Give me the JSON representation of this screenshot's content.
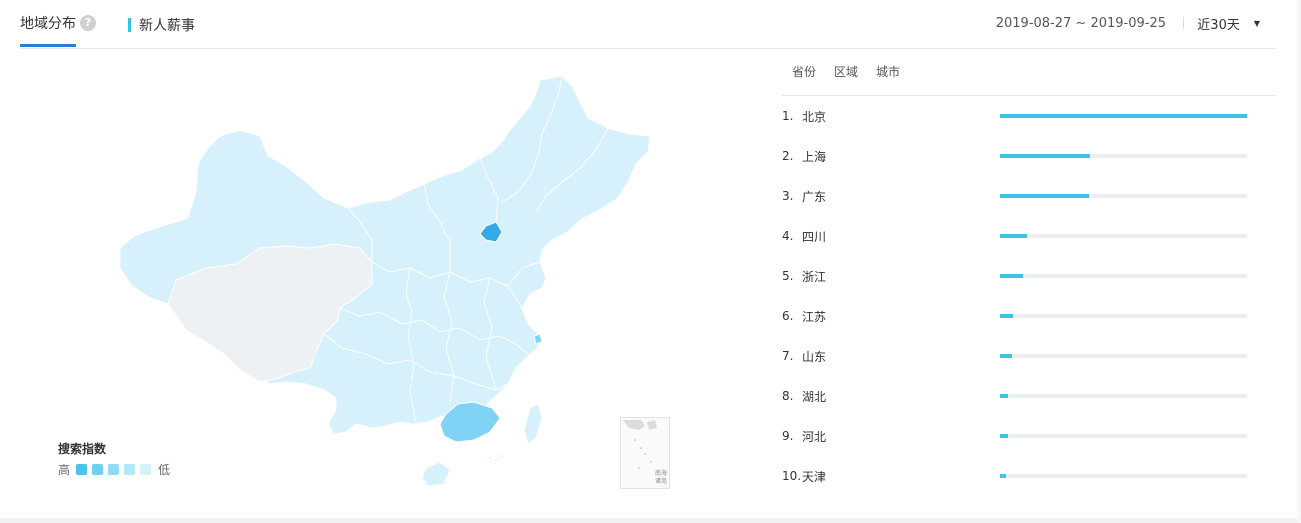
{
  "header": {
    "tab_region": "地域分布",
    "tab_people": "新人薪事",
    "help_icon": "?",
    "date_range": "2019-08-27 ~ 2019-09-25",
    "period": "近30天"
  },
  "map": {
    "legend_title": "搜索指数",
    "legend_high": "高",
    "legend_low": "低",
    "legend_colors": [
      "#4cc3ef",
      "#6fd0f2",
      "#8fdbf5",
      "#b3e7f8",
      "#d5f1fa"
    ],
    "inset_label_1": "南海",
    "inset_label_2": "诸岛",
    "colors": {
      "highest": "#35a8e6",
      "high": "#7fd3f4",
      "base": "#d6f1fb",
      "none": "#eef1f4"
    }
  },
  "ranking": {
    "tabs": [
      "省份",
      "区域",
      "城市"
    ],
    "items": [
      {
        "rank": "1.",
        "name": "北京",
        "value": 1.0
      },
      {
        "rank": "2.",
        "name": "上海",
        "value": 0.365
      },
      {
        "rank": "3.",
        "name": "广东",
        "value": 0.36
      },
      {
        "rank": "4.",
        "name": "四川",
        "value": 0.11
      },
      {
        "rank": "5.",
        "name": "浙江",
        "value": 0.095
      },
      {
        "rank": "6.",
        "name": "江苏",
        "value": 0.052
      },
      {
        "rank": "7.",
        "name": "山东",
        "value": 0.048
      },
      {
        "rank": "8.",
        "name": "湖北",
        "value": 0.034
      },
      {
        "rank": "9.",
        "name": "河北",
        "value": 0.034
      },
      {
        "rank": "10.",
        "name": "天津",
        "value": 0.026
      }
    ]
  }
}
